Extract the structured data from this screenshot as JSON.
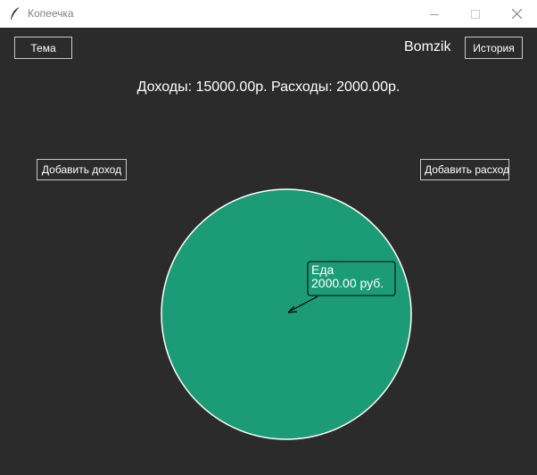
{
  "window": {
    "title": "Копеечка",
    "controls": {
      "minimize": "—",
      "maximize": "☐",
      "close": "✕"
    }
  },
  "header": {
    "theme_label": "Тема",
    "username": "Bomzik",
    "history_label": "История"
  },
  "summary_text": "Доходы: 15000.00р. Расходы: 2000.00р.",
  "actions": {
    "add_income_label": "Добавить доход",
    "add_expense_label": "Добавить расход"
  },
  "colors": {
    "background": "#2b2b2b",
    "slice": "#1c9c76",
    "label_box": "#1c9c76"
  },
  "chart_data": {
    "type": "pie",
    "slices": [
      {
        "category": "Еда",
        "value": 2000.0,
        "label": "2000.00 руб."
      }
    ]
  }
}
